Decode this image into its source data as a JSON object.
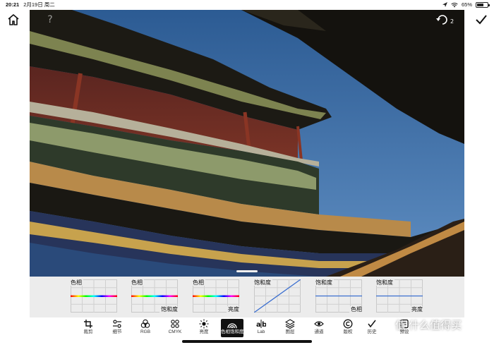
{
  "status_bar": {
    "time": "20:21",
    "date": "2月19日 周二",
    "battery": "65%",
    "battery_level": 0.65
  },
  "photo": {
    "subject": "palace-tower",
    "colors": {
      "sky": "#3a6ea8",
      "wall": "#6b2a22",
      "roof": "#1b1a14",
      "trim": "#8a8f5a"
    }
  },
  "curves": [
    {
      "top_label": "色相",
      "bottom_label": "",
      "curve": "flat",
      "line": "hue"
    },
    {
      "top_label": "色相",
      "bottom_label": "饱和度",
      "curve": "flat",
      "line": "hue"
    },
    {
      "top_label": "色相",
      "bottom_label": "亮度",
      "curve": "flat",
      "line": "hue"
    },
    {
      "top_label": "饱和度",
      "bottom_label": "",
      "curve": "diagonal",
      "line": "blue"
    },
    {
      "top_label": "饱和度",
      "bottom_label": "色相",
      "curve": "flat",
      "line": "blue"
    },
    {
      "top_label": "饱和度",
      "bottom_label": "亮度",
      "curve": "flat",
      "line": "blue"
    }
  ],
  "toolbar": {
    "tools": [
      {
        "label": "裁剪",
        "icon": "crop-icon",
        "active": false
      },
      {
        "label": "细节",
        "icon": "detail-icon",
        "active": false
      },
      {
        "label": "RGB",
        "icon": "rgb-icon",
        "active": false
      },
      {
        "label": "CMYK",
        "icon": "cmyk-icon",
        "active": false
      },
      {
        "label": "亮度",
        "icon": "brightness-icon",
        "active": false
      },
      {
        "label": "色相饱和度",
        "icon": "hue-saturation-icon",
        "active": true
      },
      {
        "label": "Lab",
        "icon": "lab-icon",
        "active": false
      },
      {
        "label": "图层",
        "icon": "layers-icon",
        "active": false
      },
      {
        "label": "通道",
        "icon": "channel-icon",
        "active": false
      },
      {
        "label": "版权",
        "icon": "copyright-icon",
        "active": false
      },
      {
        "label": "历史",
        "icon": "history-icon",
        "active": false
      },
      {
        "label": "预设",
        "icon": "preset-icon",
        "active": false
      }
    ]
  },
  "watermark": "值 什么值得买"
}
